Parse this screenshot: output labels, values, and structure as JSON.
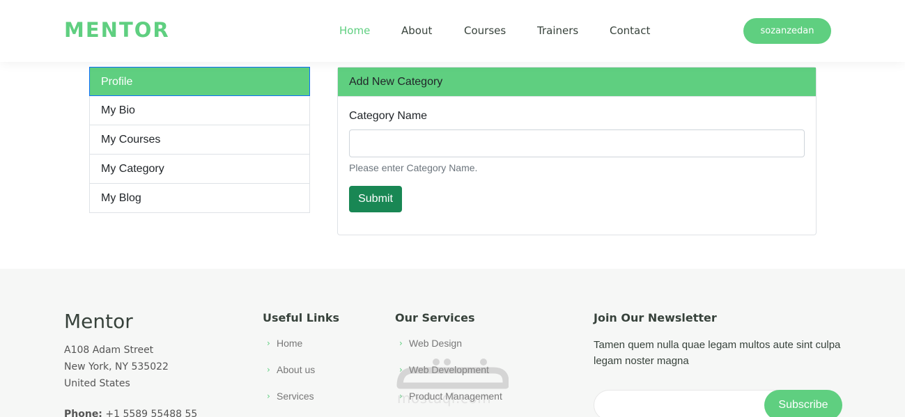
{
  "header": {
    "logo": "MENTOR",
    "nav": [
      {
        "label": "Home",
        "active": true
      },
      {
        "label": "About",
        "active": false
      },
      {
        "label": "Courses",
        "active": false
      },
      {
        "label": "Trainers",
        "active": false
      },
      {
        "label": "Contact",
        "active": false
      }
    ],
    "user_button": "sozanzedan"
  },
  "sidebar": {
    "items": [
      {
        "label": "Profile",
        "active": true
      },
      {
        "label": "My Bio",
        "active": false
      },
      {
        "label": "My Courses",
        "active": false
      },
      {
        "label": "My Category",
        "active": false
      },
      {
        "label": "My Blog",
        "active": false
      }
    ]
  },
  "card": {
    "title": "Add New Category",
    "field_label": "Category Name",
    "field_value": "",
    "help_text": "Please enter Category Name.",
    "submit_label": "Submit"
  },
  "footer": {
    "brand": "Mentor",
    "address": [
      "A108 Adam Street",
      "New York, NY 535022",
      "United States"
    ],
    "phone_label": "Phone:",
    "phone_value": "+1 5589 55488 55",
    "useful_links": {
      "heading": "Useful Links",
      "items": [
        "Home",
        "About us",
        "Services"
      ]
    },
    "services": {
      "heading": "Our Services",
      "items": [
        "Web Design",
        "Web Development",
        "Product Management"
      ]
    },
    "newsletter": {
      "heading": "Join Our Newsletter",
      "text": "Tamen quem nulla quae legam multos aute sint culpa legam noster magna",
      "input_value": "",
      "button": "Subscribe"
    }
  },
  "watermark": {
    "text": "mostaql.com"
  },
  "colors": {
    "accent": "#5fcf80",
    "submit": "#198754",
    "footer_bg": "#f6f7f6",
    "text": "#37423b"
  }
}
